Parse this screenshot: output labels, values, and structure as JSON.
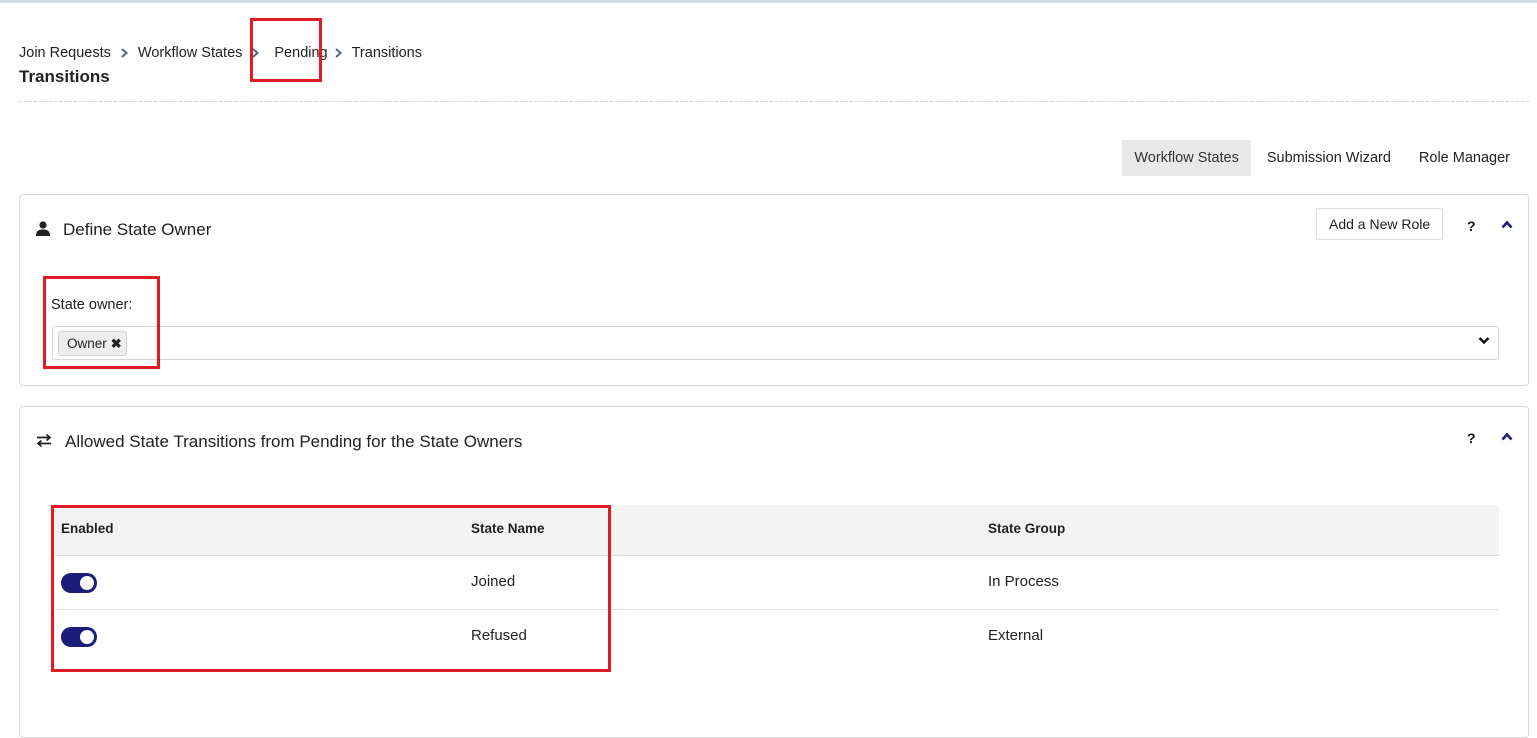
{
  "breadcrumb": {
    "items": [
      "Join Requests",
      "Workflow States",
      "Pending",
      "Transitions"
    ]
  },
  "page_title": "Transitions",
  "nav_tabs": [
    {
      "label": "Workflow States",
      "active": true
    },
    {
      "label": "Submission Wizard",
      "active": false
    },
    {
      "label": "Role Manager",
      "active": false
    }
  ],
  "state_owner_panel": {
    "icon": "user-icon",
    "title": "Define State Owner",
    "add_role_label": "Add a New Role",
    "help_label": "?",
    "field_label": "State owner:",
    "selected_chips": [
      "Owner"
    ],
    "chip_remove_symbol": "✖"
  },
  "transitions_panel": {
    "icon": "transfer-arrows-icon",
    "title": "Allowed State Transitions from Pending for the State Owners",
    "help_label": "?",
    "table": {
      "headers": [
        "Enabled",
        "State Name",
        "State Group"
      ],
      "rows": [
        {
          "enabled": true,
          "state_name": "Joined",
          "state_group": "In Process"
        },
        {
          "enabled": true,
          "state_name": "Refused",
          "state_group": "External"
        }
      ]
    }
  },
  "colors": {
    "accent": "#1c1c7a",
    "highlight": "#e01b24",
    "active_tab_bg": "#e9e9e9"
  }
}
